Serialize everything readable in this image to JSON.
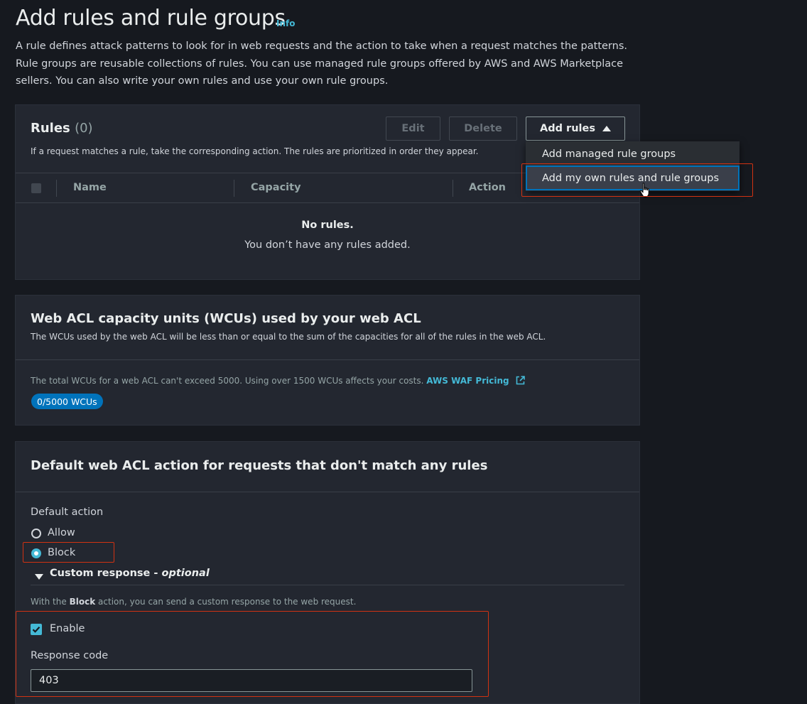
{
  "header": {
    "title": "Add rules and rule groups",
    "info": "Info",
    "description": "A rule defines attack patterns to look for in web requests and the action to take when a request matches the patterns. Rule groups are reusable collections of rules. You can use managed rule groups offered by AWS and AWS Marketplace sellers. You can also write your own rules and use your own rule groups."
  },
  "rules": {
    "title": "Rules",
    "count": "(0)",
    "description": "If a request matches a rule, take the corresponding action. The rules are prioritized in order they appear.",
    "edit_label": "Edit",
    "delete_label": "Delete",
    "add_rules_label": "Add rules",
    "dropdown": {
      "items": [
        "Add managed rule groups",
        "Add my own rules and rule groups"
      ]
    },
    "columns": [
      "Name",
      "Capacity",
      "Action"
    ],
    "empty_title": "No rules.",
    "empty_sub": "You don’t have any rules added."
  },
  "wcu": {
    "title": "Web ACL capacity units (WCUs) used by your web ACL",
    "description": "The WCUs used by the web ACL will be less than or equal to the sum of the capacities for all of the rules in the web ACL.",
    "note": "The total WCUs for a web ACL can't exceed 5000. Using over 1500 WCUs affects your costs.",
    "pricing_link": "AWS WAF Pricing",
    "badge": "0/5000 WCUs"
  },
  "default_action": {
    "title": "Default web ACL action for requests that don't match any rules",
    "label": "Default action",
    "options": [
      "Allow",
      "Block"
    ],
    "selected": "Block",
    "custom_response_label": "Custom response -",
    "custom_response_optional": "optional",
    "block_note_prefix": "With the",
    "block_note_bold": "Block",
    "block_note_suffix": "action, you can send a custom response to the web request.",
    "enable_label": "Enable",
    "enable_checked": true,
    "response_code_label": "Response code",
    "response_code_value": "403"
  },
  "colors": {
    "accent": "#44b9d6",
    "highlight_box": "#d13212",
    "badge_bg": "#0073bb"
  }
}
